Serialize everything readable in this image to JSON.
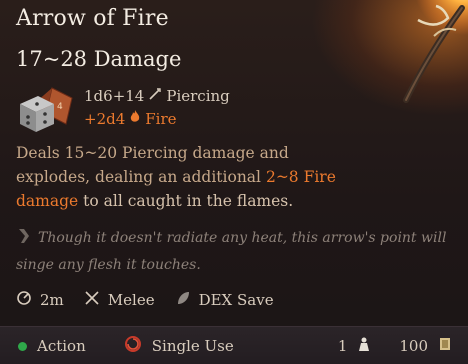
{
  "item": {
    "title": "Arrow of Fire",
    "damage_range": "17~28 Damage"
  },
  "damage": {
    "base": "1d6+14",
    "base_type": "Piercing",
    "bonus": "+2d4",
    "bonus_type": "Fire"
  },
  "description": {
    "part1": "Deals 15~20 Piercing damage and",
    "part2": "explodes, dealing an additional",
    "fire_value": "2~8 Fire",
    "fire_word": "damage",
    "part3": "to all caught in the flames."
  },
  "flavor_text": "Though it doesn't radiate any heat, this arrow's point will singe any flesh it touches.",
  "properties": {
    "range": "2m",
    "attack_type": "Melee",
    "save": "DEX Save"
  },
  "footer": {
    "cost": "Action",
    "use": "Single Use",
    "quantity": "1",
    "value": "100"
  },
  "colors": {
    "fire": "#ec7a2e",
    "action_dot": "#2fa84a"
  }
}
